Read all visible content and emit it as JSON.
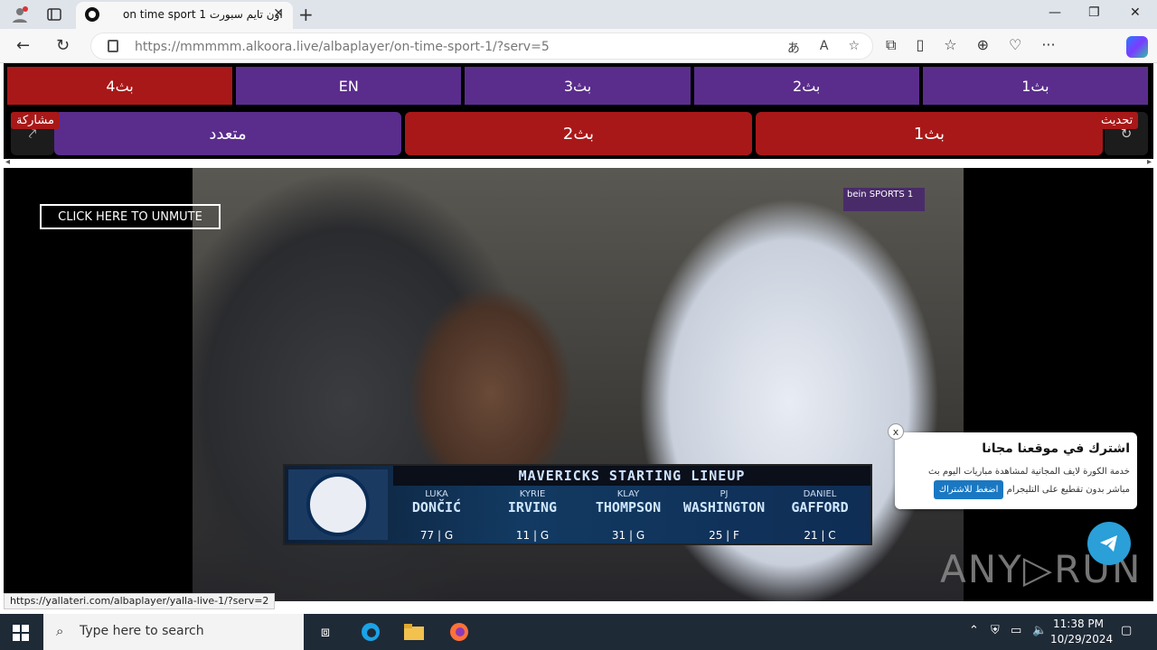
{
  "browser": {
    "tab_title": "on time sport 1 اون تايم سبورت",
    "url_domain": "https://mmmmm.alkoora.live",
    "url_path": "/albaplayer/on-time-sport-1/?serv=5"
  },
  "servers": [
    {
      "label": "بث1"
    },
    {
      "label": "بث2"
    },
    {
      "label": "بث3"
    },
    {
      "label": "EN"
    },
    {
      "label": "بث4"
    }
  ],
  "quality": {
    "q1": "بث1",
    "q2": "بث2",
    "multi": "متعدد",
    "refresh_tag": "تحديث",
    "share_tag": "مشاركة"
  },
  "video": {
    "unmute": "CLICK HERE TO UNMUTE",
    "channel_logo": "bein SPORTS 1",
    "lineup_title": "MAVERICKS STARTING LINEUP",
    "players": [
      {
        "first": "LUKA",
        "last": "DONČIĆ",
        "num": "77 | G"
      },
      {
        "first": "KYRIE",
        "last": "IRVING",
        "num": "11 | G"
      },
      {
        "first": "KLAY",
        "last": "THOMPSON",
        "num": "31 | G"
      },
      {
        "first": "PJ",
        "last": "WASHINGTON",
        "num": "25 | F"
      },
      {
        "first": "DANIEL",
        "last": "GAFFORD",
        "num": "21 | C"
      }
    ]
  },
  "popup": {
    "title": "اشترك في موقعنا مجانا",
    "desc1": "خدمة الكورة لايف المجانية لمشاهدة مباريات اليوم بث",
    "desc2": "مباشر بدون تقطيع على التليجرام",
    "button": "اضغط للاشتراك",
    "close": "x"
  },
  "watermark": "ANY▷RUN",
  "status_url": "https://yallateri.com/albaplayer/yalla-live-1/?serv=2",
  "taskbar": {
    "search_placeholder": "Type here to search",
    "time": "11:38 PM",
    "date": "10/29/2024"
  }
}
